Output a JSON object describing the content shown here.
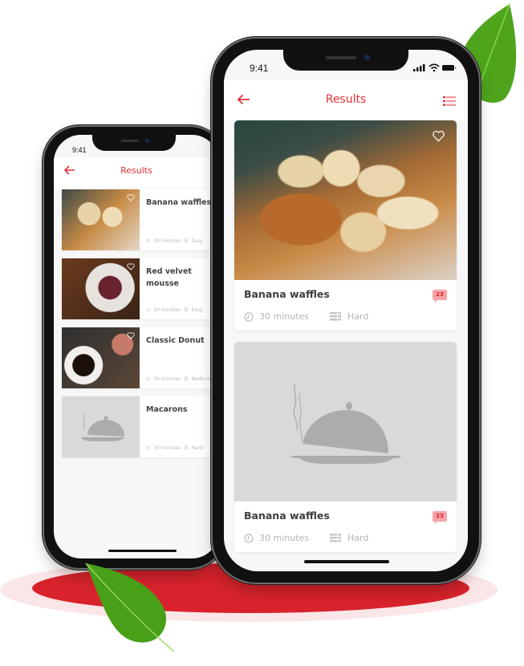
{
  "colors": {
    "accent": "#e4313a",
    "base_red": "#d8232c",
    "placeholder": "#d9d9d9",
    "badge_bg": "#f5a3a8"
  },
  "back_phone": {
    "status": {
      "time": "9:41"
    },
    "nav": {
      "title": "Results",
      "back_icon": "arrow-left-icon"
    },
    "items": [
      {
        "title": "Banana waffles",
        "time": "30 minutes",
        "difficulty": "Easy",
        "image": "banana-waffles-photo",
        "favorite_icon": "heart-outline-icon"
      },
      {
        "title": "Red velvet mousse",
        "time": "30 minutes",
        "difficulty": "Easy",
        "image": "red-velvet-mousse-photo",
        "favorite_icon": "heart-outline-icon"
      },
      {
        "title": "Classic Donut",
        "time": "30 minutes",
        "difficulty": "Medium",
        "image": "donut-coffee-photo",
        "favorite_icon": "heart-outline-icon"
      },
      {
        "title": "Macarons",
        "time": "30 minutes",
        "difficulty": "Hard",
        "image": "cloche-placeholder"
      }
    ]
  },
  "front_phone": {
    "status": {
      "time": "9:41"
    },
    "nav": {
      "title": "Results",
      "back_icon": "arrow-left-icon",
      "view_icon": "list-view-icon"
    },
    "cards": [
      {
        "title": "Banana waffles",
        "time": "30 minutes",
        "difficulty": "Hard",
        "comments": "23",
        "image": "banana-waffles-photo",
        "favorite_icon": "heart-outline-icon"
      },
      {
        "title": "Banana waffles",
        "time": "30 minutes",
        "difficulty": "Hard",
        "comments": "23",
        "image": "cloche-placeholder"
      }
    ]
  }
}
